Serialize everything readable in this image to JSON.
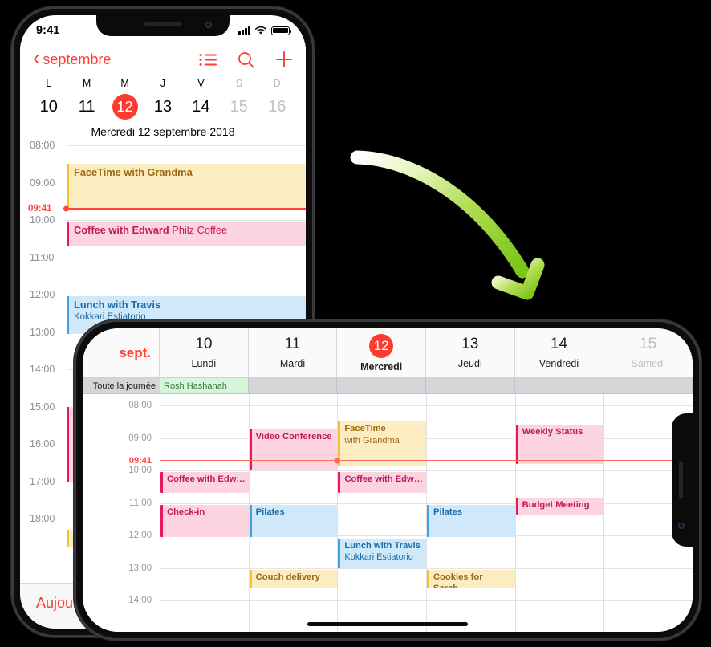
{
  "portrait": {
    "status": {
      "time": "9:41",
      "signal_icon": "cellular-signal-icon",
      "wifi_icon": "wifi-icon",
      "battery_icon": "battery-icon"
    },
    "nav": {
      "back_label": "septembre",
      "back_icon": "chevron-left-icon",
      "list_icon": "list-view-icon",
      "search_icon": "search-icon",
      "add_icon": "plus-icon"
    },
    "weekdays": [
      {
        "initial": "L",
        "num": "10",
        "state": "normal"
      },
      {
        "initial": "M",
        "num": "11",
        "state": "normal"
      },
      {
        "initial": "M",
        "num": "12",
        "state": "selected"
      },
      {
        "initial": "J",
        "num": "13",
        "state": "normal"
      },
      {
        "initial": "V",
        "num": "14",
        "state": "normal"
      },
      {
        "initial": "S",
        "num": "15",
        "state": "dim"
      },
      {
        "initial": "D",
        "num": "16",
        "state": "dim"
      }
    ],
    "date_line": "Mercredi  12 septembre 2018",
    "hours": [
      "08:00",
      "09:00",
      "10:00",
      "11:00",
      "12:00",
      "13:00",
      "14:00",
      "15:00",
      "16:00",
      "17:00",
      "18:00"
    ],
    "now": {
      "label": "09:41"
    },
    "events": [
      {
        "title": "FaceTime with Grandma",
        "sub": "",
        "color": "yellow"
      },
      {
        "title": "Coffee with Edward",
        "sub": "Philz Coffee",
        "color": "pink"
      },
      {
        "title": "Lunch with Travis",
        "sub": "Kokkari Estiatorio",
        "color": "blue"
      }
    ],
    "footer": {
      "today_label": "Aujourd'hui"
    }
  },
  "landscape": {
    "month_label": "sept.",
    "columns": [
      {
        "num": "10",
        "day": "Lundi",
        "state": "normal"
      },
      {
        "num": "11",
        "day": "Mardi",
        "state": "normal"
      },
      {
        "num": "12",
        "day": "Mercredi",
        "state": "selected"
      },
      {
        "num": "13",
        "day": "Jeudi",
        "state": "normal"
      },
      {
        "num": "14",
        "day": "Vendredi",
        "state": "normal"
      },
      {
        "num": "15",
        "day": "Samedi",
        "state": "dim"
      }
    ],
    "allday": {
      "label": "Toute la journée",
      "event": "Rosh Hashanah",
      "event_col": 0
    },
    "hours": [
      "08:00",
      "09:00",
      "10:00",
      "11:00",
      "12:00",
      "13:00",
      "14:00"
    ],
    "now": {
      "label": "09:41",
      "col": 2
    },
    "events": [
      {
        "title": "Video Conference",
        "sub": "",
        "color": "pink",
        "col": 1,
        "start": 8.75,
        "end": 10.0
      },
      {
        "title": "FaceTime",
        "sub": "with Grandma",
        "color": "yellow",
        "col": 2,
        "start": 8.5,
        "end": 9.85
      },
      {
        "title": "Weekly Status",
        "sub": "",
        "color": "pink",
        "col": 4,
        "start": 8.6,
        "end": 9.8
      },
      {
        "title": "Coffee with Edw…",
        "sub": "",
        "color": "pink",
        "col": 0,
        "start": 10.05,
        "end": 10.7
      },
      {
        "title": "Coffee with Edw…",
        "sub": "",
        "color": "pink",
        "col": 2,
        "start": 10.05,
        "end": 10.7
      },
      {
        "title": "Budget Meeting",
        "sub": "",
        "color": "pink",
        "col": 4,
        "start": 10.85,
        "end": 11.35
      },
      {
        "title": "Check-in",
        "sub": "",
        "color": "pink",
        "col": 0,
        "start": 11.05,
        "end": 12.05
      },
      {
        "title": "Pilates",
        "sub": "",
        "color": "blue",
        "col": 1,
        "start": 11.05,
        "end": 12.05
      },
      {
        "title": "Pilates",
        "sub": "",
        "color": "blue",
        "col": 3,
        "start": 11.05,
        "end": 12.05
      },
      {
        "title": "Lunch with Travis",
        "sub": "Kokkari Estiatorio",
        "color": "blue",
        "col": 2,
        "start": 12.1,
        "end": 13.0
      },
      {
        "title": "Couch delivery",
        "sub": "",
        "color": "yellow",
        "col": 1,
        "start": 13.05,
        "end": 13.6
      },
      {
        "title": "Cookies for Sarah…",
        "sub": "",
        "color": "yellow",
        "col": 3,
        "start": 13.05,
        "end": 13.6
      }
    ]
  },
  "arrow": {
    "icon": "curved-arrow-icon",
    "color_start": "#ffffff",
    "color_end": "#7ed321"
  },
  "colors": {
    "accent_red": "#ff3b30",
    "event_pink_bg": "#fcd4e0",
    "event_pink_bar": "#e8175d",
    "event_pink_text": "#c2185b",
    "event_yellow_bg": "#fbecc2",
    "event_yellow_bar": "#f2c230",
    "event_yellow_text": "#9a6a12",
    "event_blue_bg": "#cfe9fb",
    "event_blue_bar": "#3fa0e8",
    "event_blue_text": "#1b6ca8",
    "allday_green_bg": "#d7f5d9",
    "allday_green_text": "#2f7d3a"
  }
}
